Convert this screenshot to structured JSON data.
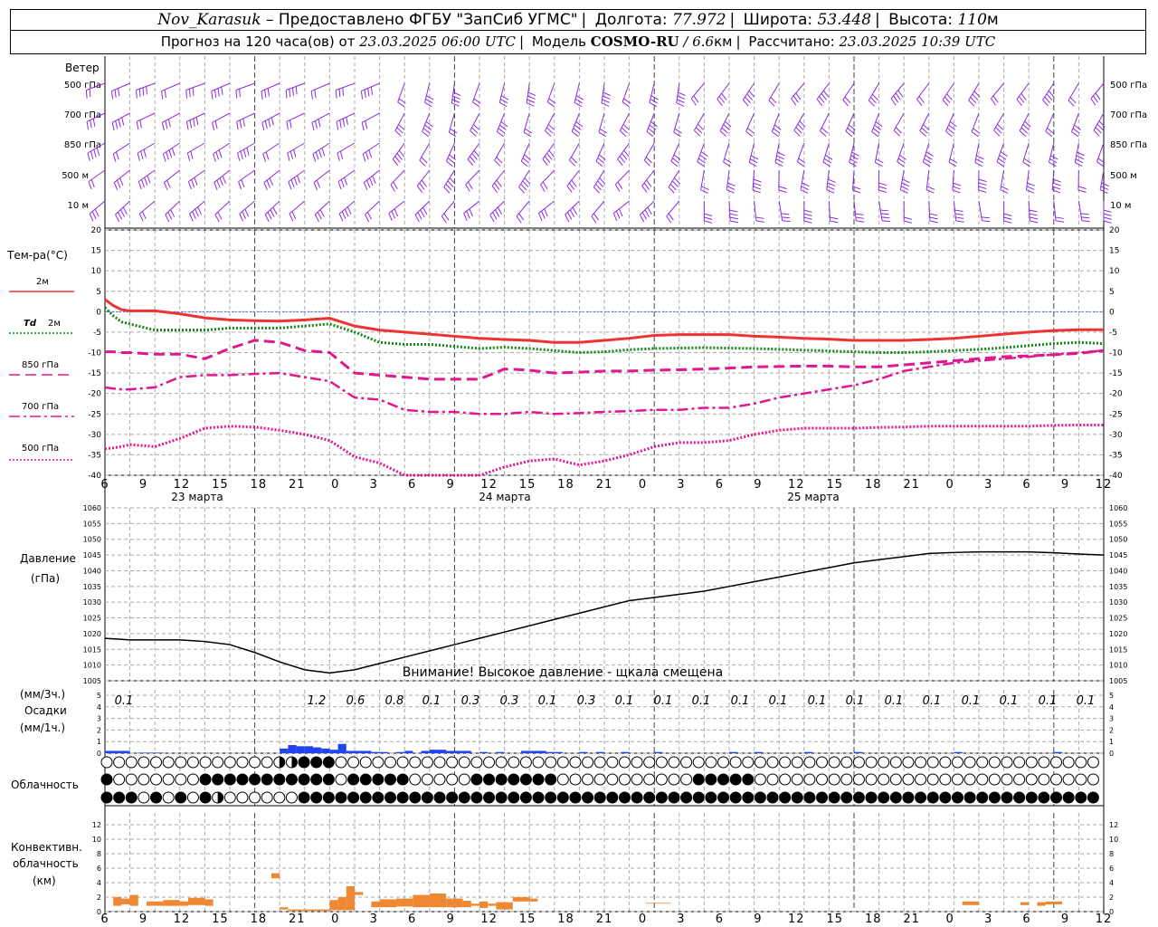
{
  "header": {
    "station": "Nov_Karasuk",
    "provider": "– Предоставлено ФГБУ \"ЗапСиб УГМС\"",
    "lon_label": "Долгота:",
    "lon_value": "77.972",
    "lat_label": "Широта:",
    "lat_value": "53.448",
    "alt_label": "Высота:",
    "alt_value": "110",
    "alt_unit": "м",
    "forecast_label": "Прогноз на 120 часа(ов) от",
    "forecast_from": "23.03.2025 06:00 UTC",
    "model_label": "Модель",
    "model_name": "COSMO-RU",
    "model_res_sep": "/",
    "model_res": "6.6",
    "model_res_unit": "км",
    "calc_label": "Рассчитано:",
    "calc_value": "23.03.2025 10:39 UTC"
  },
  "wind_panel": {
    "title": "Ветер",
    "levels": [
      "500 гПа",
      "700 гПа",
      "850 гПа",
      "500 м",
      "10 м"
    ],
    "color": "#8a2be2"
  },
  "temp_panel": {
    "title": "Тем-ра(°С)",
    "legend": [
      {
        "label": "2м",
        "color": "#ee3333",
        "style": "solid"
      },
      {
        "label": "Td",
        "label2": "2м",
        "color": "#118811",
        "style": "dotted"
      },
      {
        "label": "850 гПа",
        "color": "#e0188c",
        "style": "dash"
      },
      {
        "label": "700 гПа",
        "color": "#e0188c",
        "style": "dashdot"
      },
      {
        "label": "500 гПа",
        "color": "#e0188c",
        "style": "dotted"
      }
    ],
    "yticks": [
      "20",
      "15",
      "10",
      "5",
      "0",
      "-5",
      "-10",
      "-15",
      "-20",
      "-25",
      "-30",
      "-35",
      "-40"
    ]
  },
  "time_axis": {
    "hour_labels": [
      "6",
      "9",
      "12",
      "15",
      "18",
      "21",
      "0",
      "3",
      "6",
      "9",
      "12",
      "15",
      "18",
      "21",
      "0",
      "3",
      "6",
      "9",
      "12",
      "15",
      "18",
      "21",
      "0",
      "3",
      "6",
      "9",
      "12"
    ],
    "days": [
      "23 марта",
      "24 марта",
      "25 марта"
    ]
  },
  "pressure_panel": {
    "title": "Давление",
    "unit": "(гПа)",
    "yticks": [
      "1060",
      "1055",
      "1050",
      "1045",
      "1040",
      "1035",
      "1030",
      "1025",
      "1020",
      "1015",
      "1010",
      "1005"
    ],
    "warning": "Внимание! Высокое давление - щкала смещена"
  },
  "precip_panel": {
    "unit3": "(мм/3ч.)",
    "title": "Осадки",
    "unit1": "(мм/1ч.)",
    "yticks": [
      "5",
      "4",
      "3",
      "2",
      "1",
      "0"
    ],
    "totals": [
      "0.1",
      "1.2",
      "0.6",
      "0.8",
      "0.1",
      "0.3",
      "0.3",
      "0.1",
      "0.3",
      "0.1",
      "0.1",
      "0.1",
      "0.1",
      "0.1",
      "0.1",
      "0.1",
      "0.1",
      "0.1",
      "0.1",
      "0.1",
      "0.1",
      "0.1"
    ]
  },
  "cloud_panel": {
    "title": "Облачность"
  },
  "conv_panel": {
    "title1": "Конвективн.",
    "title2": "облачность",
    "unit": "(км)",
    "yticks": [
      "12",
      "10",
      "8",
      "6",
      "4",
      "2",
      "0"
    ]
  },
  "chart_data": [
    {
      "type": "line",
      "title": "Тем-ра(°С)",
      "x_hours_from_start": [
        0,
        1,
        2,
        3,
        6,
        9,
        12,
        15,
        18,
        21,
        24,
        27,
        30,
        33,
        36,
        39,
        42,
        45,
        48,
        51,
        54,
        57,
        60,
        63,
        66,
        69,
        72,
        75,
        78,
        81,
        84,
        87,
        90,
        93,
        96,
        99,
        102,
        105,
        108,
        111,
        114,
        117,
        120
      ],
      "x_start": "23.03.2025 06:00 UTC",
      "ylim": [
        -40,
        20
      ],
      "series": [
        {
          "name": "2м",
          "values": [
            3,
            1.5,
            0.5,
            0.2,
            0.2,
            -0.5,
            -1.5,
            -2,
            -2.2,
            -2.3,
            -2,
            -1.6,
            -3.5,
            -4.5,
            -5,
            -5.5,
            -6,
            -6.5,
            -6.8,
            -7,
            -7.5,
            -7.5,
            -7,
            -6.5,
            -5.8,
            -5.6,
            -5.6,
            -5.6,
            -6,
            -6.2,
            -6.5,
            -6.7,
            -7,
            -7,
            -7,
            -6.8,
            -6.5,
            -6,
            -5.5,
            -5,
            -4.6,
            -4.4,
            -4.4
          ]
        },
        {
          "name": "Td 2м",
          "values": [
            1,
            -1,
            -2.5,
            -3,
            -4.5,
            -4.5,
            -4.5,
            -4,
            -4,
            -4,
            -3.5,
            -3,
            -5,
            -7.5,
            -8,
            -8,
            -8.5,
            -9,
            -8.7,
            -9,
            -9.5,
            -10,
            -9.8,
            -9.3,
            -9,
            -8.9,
            -8.8,
            -8.9,
            -9,
            -9.2,
            -9.4,
            -9.6,
            -9.8,
            -10,
            -10,
            -9.8,
            -9.5,
            -9.2,
            -8.8,
            -8.3,
            -7.8,
            -7.5,
            -7.8
          ]
        },
        {
          "name": "850 гПа",
          "values": [
            -9.8,
            -9.8,
            -10,
            -10,
            -10.4,
            -10.4,
            -11.5,
            -9,
            -7,
            -7.5,
            -9.5,
            -10,
            -15,
            -15.5,
            -16,
            -16.5,
            -16.5,
            -16.5,
            -14,
            -14.3,
            -15,
            -14.8,
            -14.5,
            -14.5,
            -14.3,
            -14.2,
            -14,
            -13.8,
            -13.5,
            -13.4,
            -13.3,
            -13.3,
            -13.5,
            -13.5,
            -13,
            -12.5,
            -12,
            -11.5,
            -11,
            -10.8,
            -10.5,
            -10.2,
            -9.5
          ]
        },
        {
          "name": "700 гПа",
          "values": [
            -18.5,
            -18.8,
            -19,
            -19,
            -18.5,
            -16,
            -15.5,
            -15.5,
            -15.2,
            -15,
            -16,
            -17,
            -21,
            -21.5,
            -24,
            -24.5,
            -24.5,
            -25,
            -25,
            -24.5,
            -25,
            -24.8,
            -24.5,
            -24.3,
            -24,
            -24,
            -23.5,
            -23.5,
            -22.5,
            -21,
            -20,
            -19,
            -18,
            -16.5,
            -14.5,
            -13.5,
            -12.5,
            -12,
            -11.5,
            -11,
            -10.5,
            -10,
            -9.5
          ]
        },
        {
          "name": "500 гПа",
          "values": [
            -33.5,
            -33.3,
            -33,
            -32.5,
            -33,
            -31,
            -28.5,
            -28,
            -28.2,
            -29,
            -30,
            -31.5,
            -35.5,
            -37,
            -40,
            -41,
            -42,
            -42,
            -38,
            -36.5,
            -36,
            -37.5,
            -36.5,
            -35,
            -33,
            -32,
            -32,
            -31.5,
            -30,
            -29,
            -28.5,
            -28.5,
            -28.5,
            -28.3,
            -28.2,
            -28,
            -28,
            -28,
            -28,
            -28,
            -27.8,
            -27.7,
            -27.7
          ]
        }
      ]
    },
    {
      "type": "line",
      "title": "Давление",
      "ylabel": "(гПа)",
      "ylim": [
        1005,
        1060
      ],
      "x_hours_from_start": [
        0,
        3,
        6,
        9,
        12,
        15,
        18,
        21,
        24,
        27,
        30,
        33,
        36,
        39,
        42,
        45,
        48,
        51,
        54,
        57,
        60,
        63,
        66,
        69,
        72,
        75,
        78,
        81,
        84,
        87,
        90,
        93,
        96,
        99,
        102,
        105,
        108,
        111,
        114,
        117,
        120
      ],
      "values": [
        1018.5,
        1018,
        1018,
        1018,
        1017.5,
        1016.5,
        1014,
        1011,
        1008.5,
        1007.5,
        1008.5,
        1010.5,
        1012.5,
        1014.5,
        1016.5,
        1018.5,
        1020.5,
        1022.5,
        1024.5,
        1026.5,
        1028.5,
        1030.5,
        1031.5,
        1032.5,
        1033.5,
        1035,
        1036.5,
        1038,
        1039.5,
        1041,
        1042.5,
        1043.5,
        1044.5,
        1045.5,
        1045.8,
        1046,
        1046,
        1046,
        1045.7,
        1045.3,
        1045
      ]
    },
    {
      "type": "bar",
      "title": "Осадки",
      "ylabel": "(мм/1ч.)",
      "ylim": [
        0,
        5
      ],
      "x_hours_from_start": [
        0,
        1,
        2,
        4,
        5,
        6,
        21,
        22,
        23,
        24,
        25,
        26,
        27,
        28,
        29,
        30,
        31,
        32,
        33,
        35,
        36,
        38,
        39,
        40,
        41,
        42,
        43,
        45,
        47,
        50,
        51,
        52,
        53,
        54,
        57,
        59,
        62,
        66,
        75,
        78,
        84,
        90,
        102,
        114
      ],
      "values": [
        0.2,
        0.2,
        0.2,
        0.05,
        0.05,
        0.05,
        0.4,
        0.7,
        0.6,
        0.6,
        0.5,
        0.4,
        0.3,
        0.8,
        0.2,
        0.2,
        0.2,
        0.1,
        0.1,
        0.1,
        0.2,
        0.2,
        0.3,
        0.3,
        0.2,
        0.2,
        0.2,
        0.1,
        0.1,
        0.2,
        0.2,
        0.2,
        0.1,
        0.1,
        0.1,
        0.1,
        0.1,
        0.1,
        0.1,
        0.1,
        0.1,
        0.1,
        0.1,
        0.1
      ]
    },
    {
      "type": "bar",
      "title": "Конвективн. облачность",
      "ylabel": "(км)",
      "ylim": [
        0,
        13
      ],
      "bars": [
        {
          "x0": 1,
          "x1": 2,
          "bot": 0.8,
          "top": 2.0
        },
        {
          "x0": 2,
          "x1": 3,
          "bot": 1.0,
          "top": 1.8
        },
        {
          "x0": 3,
          "x1": 4,
          "bot": 0.8,
          "top": 2.3
        },
        {
          "x0": 5,
          "x1": 7,
          "bot": 0.8,
          "top": 1.4
        },
        {
          "x0": 7,
          "x1": 9,
          "bot": 0.8,
          "top": 1.6
        },
        {
          "x0": 9,
          "x1": 10,
          "bot": 0.8,
          "top": 1.4
        },
        {
          "x0": 10,
          "x1": 12,
          "bot": 0.9,
          "top": 1.9
        },
        {
          "x0": 12,
          "x1": 13,
          "bot": 0.8,
          "top": 1.7
        },
        {
          "x0": 20,
          "x1": 21,
          "bot": 4.6,
          "top": 5.3
        },
        {
          "x0": 21,
          "x1": 22,
          "bot": 0.3,
          "top": 0.6
        },
        {
          "x0": 22,
          "x1": 27,
          "bot": 0.1,
          "top": 0.3
        },
        {
          "x0": 27,
          "x1": 28,
          "bot": 0.2,
          "top": 1.6
        },
        {
          "x0": 28,
          "x1": 29,
          "bot": 0.2,
          "top": 2.0
        },
        {
          "x0": 29,
          "x1": 30,
          "bot": 0.2,
          "top": 3.5
        },
        {
          "x0": 30,
          "x1": 31,
          "bot": 2.3,
          "top": 2.7
        },
        {
          "x0": 32,
          "x1": 33,
          "bot": 0.6,
          "top": 1.4
        },
        {
          "x0": 33,
          "x1": 35,
          "bot": 0.6,
          "top": 1.7
        },
        {
          "x0": 35,
          "x1": 37,
          "bot": 0.7,
          "top": 1.8
        },
        {
          "x0": 37,
          "x1": 39,
          "bot": 0.6,
          "top": 2.3
        },
        {
          "x0": 39,
          "x1": 41,
          "bot": 0.6,
          "top": 2.5
        },
        {
          "x0": 41,
          "x1": 43,
          "bot": 0.6,
          "top": 1.8
        },
        {
          "x0": 43,
          "x1": 44,
          "bot": 0.6,
          "top": 1.5
        },
        {
          "x0": 44,
          "x1": 45,
          "bot": 0.8,
          "top": 1.1
        },
        {
          "x0": 45,
          "x1": 46,
          "bot": 0.5,
          "top": 1.4
        },
        {
          "x0": 46,
          "x1": 47,
          "bot": 0.8,
          "top": 1.1
        },
        {
          "x0": 47,
          "x1": 49,
          "bot": 0.3,
          "top": 1.3
        },
        {
          "x0": 49,
          "x1": 51,
          "bot": 1.4,
          "top": 2.0
        },
        {
          "x0": 51,
          "x1": 52,
          "bot": 1.4,
          "top": 1.8
        },
        {
          "x0": 65,
          "x1": 68,
          "bot": 1.1,
          "top": 1.2
        },
        {
          "x0": 103,
          "x1": 105,
          "bot": 0.9,
          "top": 1.4
        },
        {
          "x0": 110,
          "x1": 111,
          "bot": 0.9,
          "top": 1.3
        },
        {
          "x0": 112,
          "x1": 113,
          "bot": 0.8,
          "top": 1.3
        },
        {
          "x0": 113,
          "x1": 115,
          "bot": 1.0,
          "top": 1.4
        }
      ]
    }
  ]
}
